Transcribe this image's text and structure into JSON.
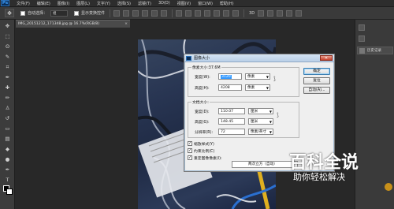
{
  "app": {
    "logo": "Ps"
  },
  "menu": [
    "文件(F)",
    "编辑(E)",
    "图像(I)",
    "图层(L)",
    "文字(Y)",
    "选择(S)",
    "滤镜(T)",
    "3D(D)",
    "视图(V)",
    "窗口(W)",
    "帮助(H)"
  ],
  "options_bar": {
    "auto_select_label": "自动选择：",
    "auto_select_value": "组",
    "show_transform_label": "显示变换控件"
  },
  "document": {
    "tab_title": "IMG_20151212_171348.jpg @ 16.7%(RGB/8)",
    "close": "×"
  },
  "right_panel": {
    "history_label": "历史记录"
  },
  "dialog": {
    "title": "图像大小",
    "close_glyph": "✕",
    "pixel_dims": {
      "title": "像素大小:37.6M",
      "width_label": "宽度(W):",
      "width_value": "3120",
      "width_unit": "像素",
      "height_label": "高度(H):",
      "height_value": "4208",
      "height_unit": "像素"
    },
    "doc_size": {
      "title": "文档大小:",
      "width_label": "宽度(D):",
      "width_value": "110.07",
      "width_unit": "厘米",
      "height_label": "高度(G):",
      "height_value": "148.45",
      "height_unit": "厘米",
      "resolution_label": "分辨率(R):",
      "resolution_value": "72",
      "resolution_unit": "像素/英寸"
    },
    "checkboxes": {
      "scale_styles": "缩放样式(Y)",
      "constrain": "约束比例(C)",
      "resample": "重定图像像素(I):"
    },
    "resample_method": "两次立方（自动）",
    "buttons": {
      "ok": "确定",
      "reset": "复位",
      "auto": "自动(A)..."
    }
  },
  "watermark": {
    "main": "百科全说",
    "sub": "助你轻松解决"
  }
}
